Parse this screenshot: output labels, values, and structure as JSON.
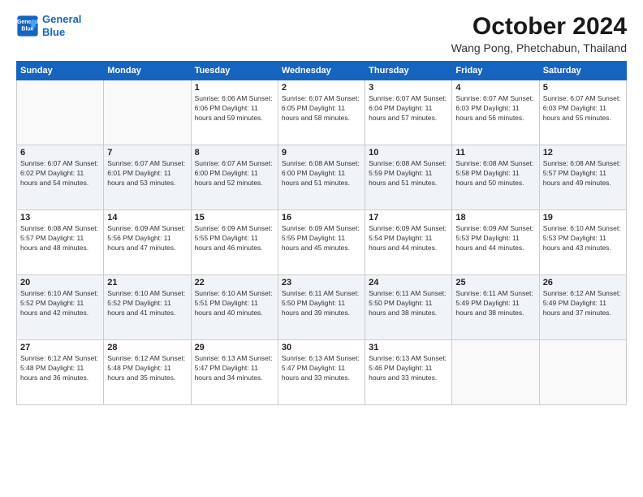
{
  "logo": {
    "line1": "General",
    "line2": "Blue"
  },
  "title": "October 2024",
  "location": "Wang Pong, Phetchabun, Thailand",
  "days_of_week": [
    "Sunday",
    "Monday",
    "Tuesday",
    "Wednesday",
    "Thursday",
    "Friday",
    "Saturday"
  ],
  "weeks": [
    [
      {
        "day": "",
        "info": ""
      },
      {
        "day": "",
        "info": ""
      },
      {
        "day": "1",
        "info": "Sunrise: 6:06 AM\nSunset: 6:06 PM\nDaylight: 11 hours and 59 minutes."
      },
      {
        "day": "2",
        "info": "Sunrise: 6:07 AM\nSunset: 6:05 PM\nDaylight: 11 hours and 58 minutes."
      },
      {
        "day": "3",
        "info": "Sunrise: 6:07 AM\nSunset: 6:04 PM\nDaylight: 11 hours and 57 minutes."
      },
      {
        "day": "4",
        "info": "Sunrise: 6:07 AM\nSunset: 6:03 PM\nDaylight: 11 hours and 56 minutes."
      },
      {
        "day": "5",
        "info": "Sunrise: 6:07 AM\nSunset: 6:03 PM\nDaylight: 11 hours and 55 minutes."
      }
    ],
    [
      {
        "day": "6",
        "info": "Sunrise: 6:07 AM\nSunset: 6:02 PM\nDaylight: 11 hours and 54 minutes."
      },
      {
        "day": "7",
        "info": "Sunrise: 6:07 AM\nSunset: 6:01 PM\nDaylight: 11 hours and 53 minutes."
      },
      {
        "day": "8",
        "info": "Sunrise: 6:07 AM\nSunset: 6:00 PM\nDaylight: 11 hours and 52 minutes."
      },
      {
        "day": "9",
        "info": "Sunrise: 6:08 AM\nSunset: 6:00 PM\nDaylight: 11 hours and 51 minutes."
      },
      {
        "day": "10",
        "info": "Sunrise: 6:08 AM\nSunset: 5:59 PM\nDaylight: 11 hours and 51 minutes."
      },
      {
        "day": "11",
        "info": "Sunrise: 6:08 AM\nSunset: 5:58 PM\nDaylight: 11 hours and 50 minutes."
      },
      {
        "day": "12",
        "info": "Sunrise: 6:08 AM\nSunset: 5:57 PM\nDaylight: 11 hours and 49 minutes."
      }
    ],
    [
      {
        "day": "13",
        "info": "Sunrise: 6:08 AM\nSunset: 5:57 PM\nDaylight: 11 hours and 48 minutes."
      },
      {
        "day": "14",
        "info": "Sunrise: 6:09 AM\nSunset: 5:56 PM\nDaylight: 11 hours and 47 minutes."
      },
      {
        "day": "15",
        "info": "Sunrise: 6:09 AM\nSunset: 5:55 PM\nDaylight: 11 hours and 46 minutes."
      },
      {
        "day": "16",
        "info": "Sunrise: 6:09 AM\nSunset: 5:55 PM\nDaylight: 11 hours and 45 minutes."
      },
      {
        "day": "17",
        "info": "Sunrise: 6:09 AM\nSunset: 5:54 PM\nDaylight: 11 hours and 44 minutes."
      },
      {
        "day": "18",
        "info": "Sunrise: 6:09 AM\nSunset: 5:53 PM\nDaylight: 11 hours and 44 minutes."
      },
      {
        "day": "19",
        "info": "Sunrise: 6:10 AM\nSunset: 5:53 PM\nDaylight: 11 hours and 43 minutes."
      }
    ],
    [
      {
        "day": "20",
        "info": "Sunrise: 6:10 AM\nSunset: 5:52 PM\nDaylight: 11 hours and 42 minutes."
      },
      {
        "day": "21",
        "info": "Sunrise: 6:10 AM\nSunset: 5:52 PM\nDaylight: 11 hours and 41 minutes."
      },
      {
        "day": "22",
        "info": "Sunrise: 6:10 AM\nSunset: 5:51 PM\nDaylight: 11 hours and 40 minutes."
      },
      {
        "day": "23",
        "info": "Sunrise: 6:11 AM\nSunset: 5:50 PM\nDaylight: 11 hours and 39 minutes."
      },
      {
        "day": "24",
        "info": "Sunrise: 6:11 AM\nSunset: 5:50 PM\nDaylight: 11 hours and 38 minutes."
      },
      {
        "day": "25",
        "info": "Sunrise: 6:11 AM\nSunset: 5:49 PM\nDaylight: 11 hours and 38 minutes."
      },
      {
        "day": "26",
        "info": "Sunrise: 6:12 AM\nSunset: 5:49 PM\nDaylight: 11 hours and 37 minutes."
      }
    ],
    [
      {
        "day": "27",
        "info": "Sunrise: 6:12 AM\nSunset: 5:48 PM\nDaylight: 11 hours and 36 minutes."
      },
      {
        "day": "28",
        "info": "Sunrise: 6:12 AM\nSunset: 5:48 PM\nDaylight: 11 hours and 35 minutes."
      },
      {
        "day": "29",
        "info": "Sunrise: 6:13 AM\nSunset: 5:47 PM\nDaylight: 11 hours and 34 minutes."
      },
      {
        "day": "30",
        "info": "Sunrise: 6:13 AM\nSunset: 5:47 PM\nDaylight: 11 hours and 33 minutes."
      },
      {
        "day": "31",
        "info": "Sunrise: 6:13 AM\nSunset: 5:46 PM\nDaylight: 11 hours and 33 minutes."
      },
      {
        "day": "",
        "info": ""
      },
      {
        "day": "",
        "info": ""
      }
    ]
  ]
}
